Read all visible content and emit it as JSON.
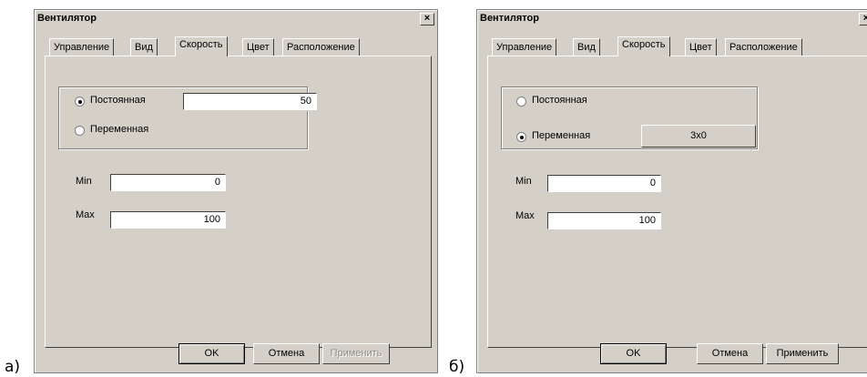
{
  "labels": {
    "a": "а)",
    "b": "б)"
  },
  "dialog_a": {
    "title": "Вентилятор",
    "close": "×",
    "tabs": [
      "Управление",
      "Вид",
      "Скорость",
      "Цвет",
      "Расположение"
    ],
    "active_tab": "Скорость",
    "radio_constant": "Постоянная",
    "radio_variable": "Переменная",
    "selected": "Постоянная",
    "constant_value": "50",
    "min_label": "Min",
    "min_value": "0",
    "max_label": "Max",
    "max_value": "100",
    "ok": "OK",
    "cancel": "Отмена",
    "apply": "Применить",
    "apply_enabled": false
  },
  "dialog_b": {
    "title": "Вентилятор",
    "close": "×",
    "tabs": [
      "Управление",
      "Вид",
      "Скорость",
      "Цвет",
      "Расположение"
    ],
    "active_tab": "Скорость",
    "radio_constant": "Постоянная",
    "radio_variable": "Переменная",
    "selected": "Переменная",
    "variable_button": "3x0",
    "min_label": "Min",
    "min_value": "0",
    "max_label": "Max",
    "max_value": "100",
    "ok": "OK",
    "cancel": "Отмена",
    "apply": "Применить",
    "apply_enabled": true
  }
}
